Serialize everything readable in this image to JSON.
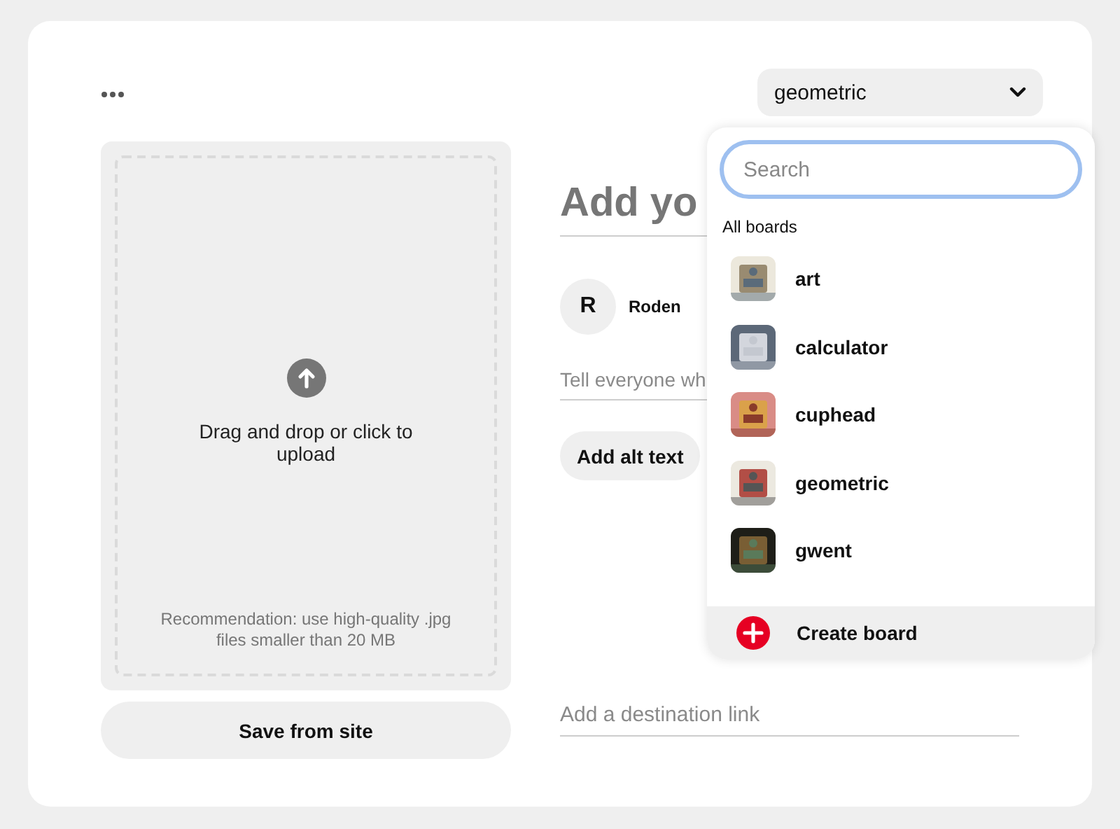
{
  "board_select": {
    "value": "geometric"
  },
  "upload": {
    "prompt": "Drag and drop or click to upload",
    "recommendation": "Recommendation: use high-quality .jpg files smaller than 20 MB"
  },
  "save_from_site": "Save from site",
  "title": {
    "placeholder": "Add yo"
  },
  "user": {
    "initial": "R",
    "name": "Roden"
  },
  "description": {
    "placeholder": "Tell everyone wh"
  },
  "alt_text_button": "Add alt text",
  "link": {
    "placeholder": "Add a destination link"
  },
  "board_menu": {
    "search": {
      "placeholder": "Search"
    },
    "section": "All boards",
    "boards": [
      {
        "name": "art"
      },
      {
        "name": "calculator"
      },
      {
        "name": "cuphead"
      },
      {
        "name": "geometric"
      },
      {
        "name": "gwent"
      }
    ],
    "create": "Create board"
  }
}
